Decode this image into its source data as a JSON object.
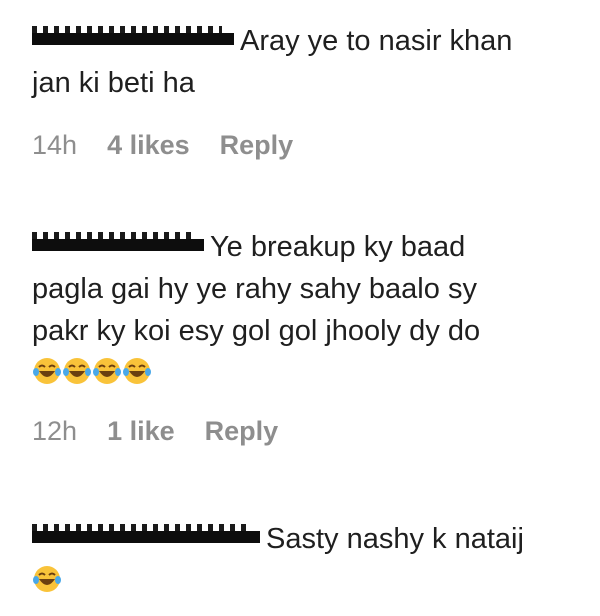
{
  "comments": [
    {
      "text": "Aray ye to nasir khan jan ki beti ha",
      "line1": "Aray ye to nasir khan",
      "line2": "jan ki beti ha",
      "time": "14h",
      "likes": "4 likes",
      "reply_label": "Reply",
      "emoji_count": 0
    },
    {
      "text": "Ye breakup ky baad pagla gai hy ye rahy sahy baalo sy pakr ky koi esy gol gol jhooly dy do",
      "line1": "Ye breakup ky baad",
      "line2": "pagla gai hy ye rahy sahy baalo sy",
      "line3": "pakr ky koi esy gol gol jhooly dy do",
      "time": "12h",
      "likes": "1 like",
      "reply_label": "Reply",
      "emoji_count": 4,
      "emoji": "face-with-tears-of-joy"
    },
    {
      "text": "Sasty nashy k nataij",
      "line1": "Sasty nashy k nataij",
      "emoji_count": 1,
      "emoji": "face-with-tears-of-joy"
    }
  ],
  "colors": {
    "text": "#1f1f1f",
    "meta": "#8e8e8e",
    "redaction": "#0d0d0d",
    "emoji_face": "#f9c33a"
  }
}
